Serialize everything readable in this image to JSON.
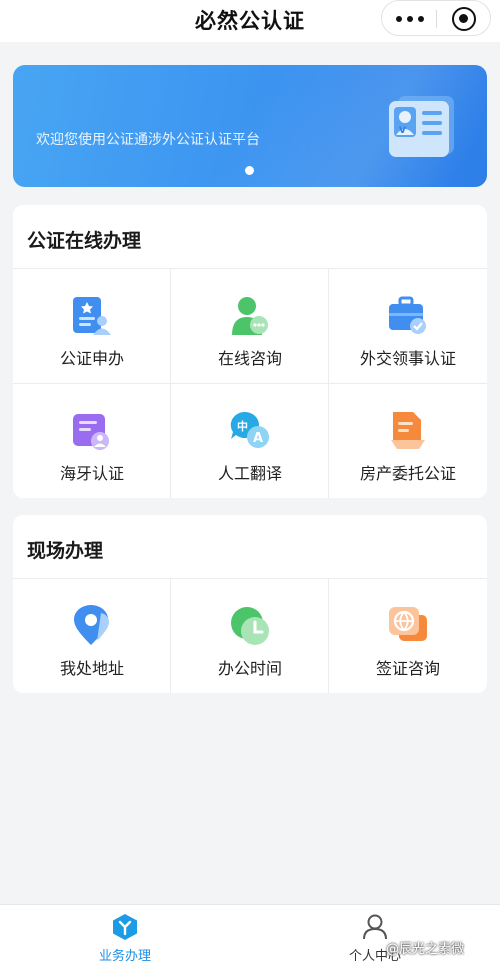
{
  "header": {
    "title": "必然公认证"
  },
  "banner": {
    "text": "欢迎您使用公证通涉外公证认证平台"
  },
  "section_online": {
    "title": "公证在线办理",
    "items": [
      {
        "label": "公证申办",
        "icon": "document-person-icon"
      },
      {
        "label": "在线咨询",
        "icon": "chat-person-icon"
      },
      {
        "label": "外交领事认证",
        "icon": "briefcase-check-icon"
      },
      {
        "label": "海牙认证",
        "icon": "document-avatar-icon"
      },
      {
        "label": "人工翻译",
        "icon": "translate-icon"
      },
      {
        "label": "房产委托公证",
        "icon": "house-document-icon"
      }
    ]
  },
  "section_onsite": {
    "title": "现场办理",
    "items": [
      {
        "label": "我处地址",
        "icon": "location-pin-icon"
      },
      {
        "label": "办公时间",
        "icon": "clock-icon"
      },
      {
        "label": "签证咨询",
        "icon": "globe-chat-icon"
      }
    ]
  },
  "tabbar": {
    "tabs": [
      {
        "label": "业务办理",
        "icon": "business-cube-icon",
        "active": true
      },
      {
        "label": "个人中心",
        "icon": "user-icon",
        "active": false
      }
    ]
  },
  "watermark": "@辰光之素微",
  "colors": {
    "accent": "#1d8fe0",
    "banner": "#3b93f0"
  }
}
